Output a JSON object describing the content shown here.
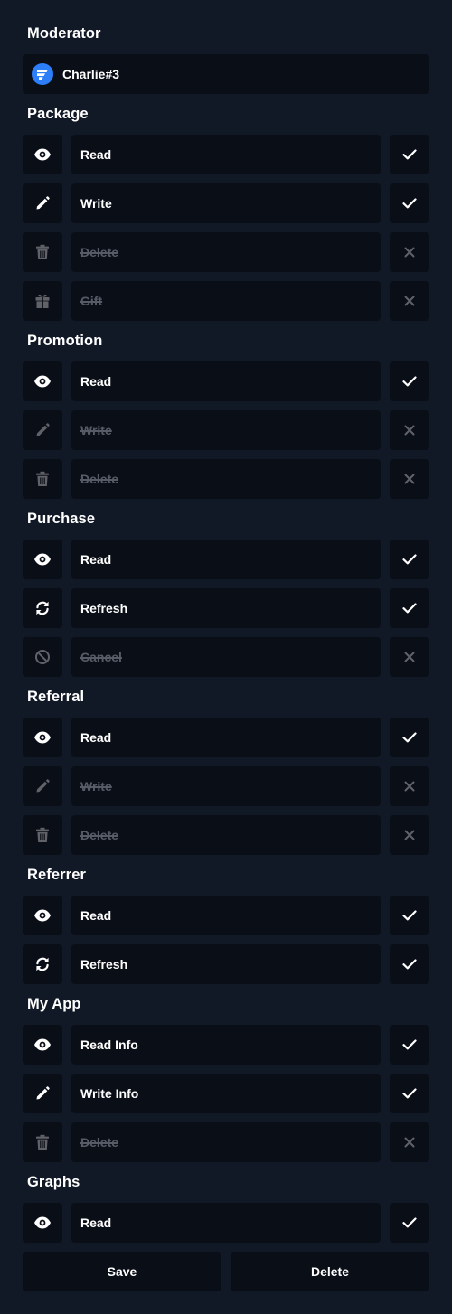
{
  "colors": {
    "background": "#111826",
    "surface": "#0a0e17",
    "text": "#ffffff",
    "disabled_text": "#565b66",
    "avatar": "#2d7ff9"
  },
  "moderator": {
    "title": "Moderator",
    "name": "Charlie#3",
    "avatar_icon": "brand-logo-icon"
  },
  "sections": [
    {
      "title": "Package",
      "permissions": [
        {
          "label": "Read",
          "icon": "eye-icon",
          "enabled": true
        },
        {
          "label": "Write",
          "icon": "pencil-icon",
          "enabled": true
        },
        {
          "label": "Delete",
          "icon": "trash-icon",
          "enabled": false
        },
        {
          "label": "Gift",
          "icon": "gift-icon",
          "enabled": false
        }
      ]
    },
    {
      "title": "Promotion",
      "permissions": [
        {
          "label": "Read",
          "icon": "eye-icon",
          "enabled": true
        },
        {
          "label": "Write",
          "icon": "pencil-icon",
          "enabled": false
        },
        {
          "label": "Delete",
          "icon": "trash-icon",
          "enabled": false
        }
      ]
    },
    {
      "title": "Purchase",
      "permissions": [
        {
          "label": "Read",
          "icon": "eye-icon",
          "enabled": true
        },
        {
          "label": "Refresh",
          "icon": "refresh-icon",
          "enabled": true
        },
        {
          "label": "Cancel",
          "icon": "ban-icon",
          "enabled": false
        }
      ]
    },
    {
      "title": "Referral",
      "permissions": [
        {
          "label": "Read",
          "icon": "eye-icon",
          "enabled": true
        },
        {
          "label": "Write",
          "icon": "pencil-icon",
          "enabled": false
        },
        {
          "label": "Delete",
          "icon": "trash-icon",
          "enabled": false
        }
      ]
    },
    {
      "title": "Referrer",
      "permissions": [
        {
          "label": "Read",
          "icon": "eye-icon",
          "enabled": true
        },
        {
          "label": "Refresh",
          "icon": "refresh-icon",
          "enabled": true
        }
      ]
    },
    {
      "title": "My App",
      "permissions": [
        {
          "label": "Read Info",
          "icon": "eye-icon",
          "enabled": true
        },
        {
          "label": "Write Info",
          "icon": "pencil-icon",
          "enabled": true
        },
        {
          "label": "Delete",
          "icon": "trash-icon",
          "enabled": false
        }
      ]
    },
    {
      "title": "Graphs",
      "permissions": [
        {
          "label": "Read",
          "icon": "eye-icon",
          "enabled": true
        }
      ]
    }
  ],
  "actions": {
    "save_label": "Save",
    "delete_label": "Delete"
  }
}
